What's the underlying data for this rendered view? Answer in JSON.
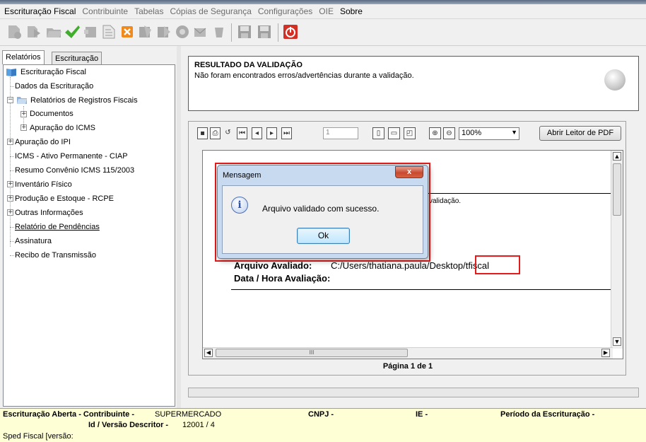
{
  "menubar": {
    "items": [
      "Escrituração Fiscal",
      "Contribuinte",
      "Tabelas",
      "Cópias de Segurança",
      "Configurações",
      "OIE",
      "Sobre"
    ]
  },
  "left_panel": {
    "tabs": [
      "Relatórios",
      "Escrituração"
    ],
    "tree": [
      "Escrituração Fiscal",
      "Dados da Escrituração",
      "Relatórios de Registros Fiscais",
      "Documentos",
      "Apuração do ICMS",
      "Apuração do IPI",
      "ICMS - Ativo Permanente - CIAP",
      "Resumo  Convênio ICMS 115/2003",
      "Inventário Físico",
      "Produção e Estoque - RCPE",
      "Outras Informações",
      "Relatório de Pendências",
      "Assinatura",
      "Recibo de Transmissão"
    ]
  },
  "result": {
    "title": "RESULTADO DA VALIDAÇÃO",
    "message": "Não foram encontrados erros/advertências durante a validação."
  },
  "pdf_viewer": {
    "page_value": "1",
    "zoom": "100%",
    "open_reader_label": "Abrir Leitor de PDF",
    "page_info": "Página 1 de 1",
    "doc": {
      "partial_text": "validação.",
      "file_label": "Arquivo Avaliado:",
      "file_path": "C:/Users/thatiana.paula/Desktop/tfiscal",
      "date_label": "Data / Hora Avaliação:",
      "hscroll_thumb": "III"
    }
  },
  "dialog": {
    "title": "Mensagem",
    "close_label": "x",
    "message": "Arquivo validado com sucesso.",
    "ok_label": "Ok"
  },
  "statusbar": {
    "line1_label": "Escrituração Aberta - Contribuinte -",
    "contributor": "SUPERMERCADO",
    "cnpj_label": "CNPJ -",
    "ie_label": "IE -",
    "period_label": "Período da Escrituração -",
    "version_label": "Id / Versão Descritor -",
    "version_value": "12001 / 4",
    "line3": "Sped Fiscal [versão:"
  }
}
